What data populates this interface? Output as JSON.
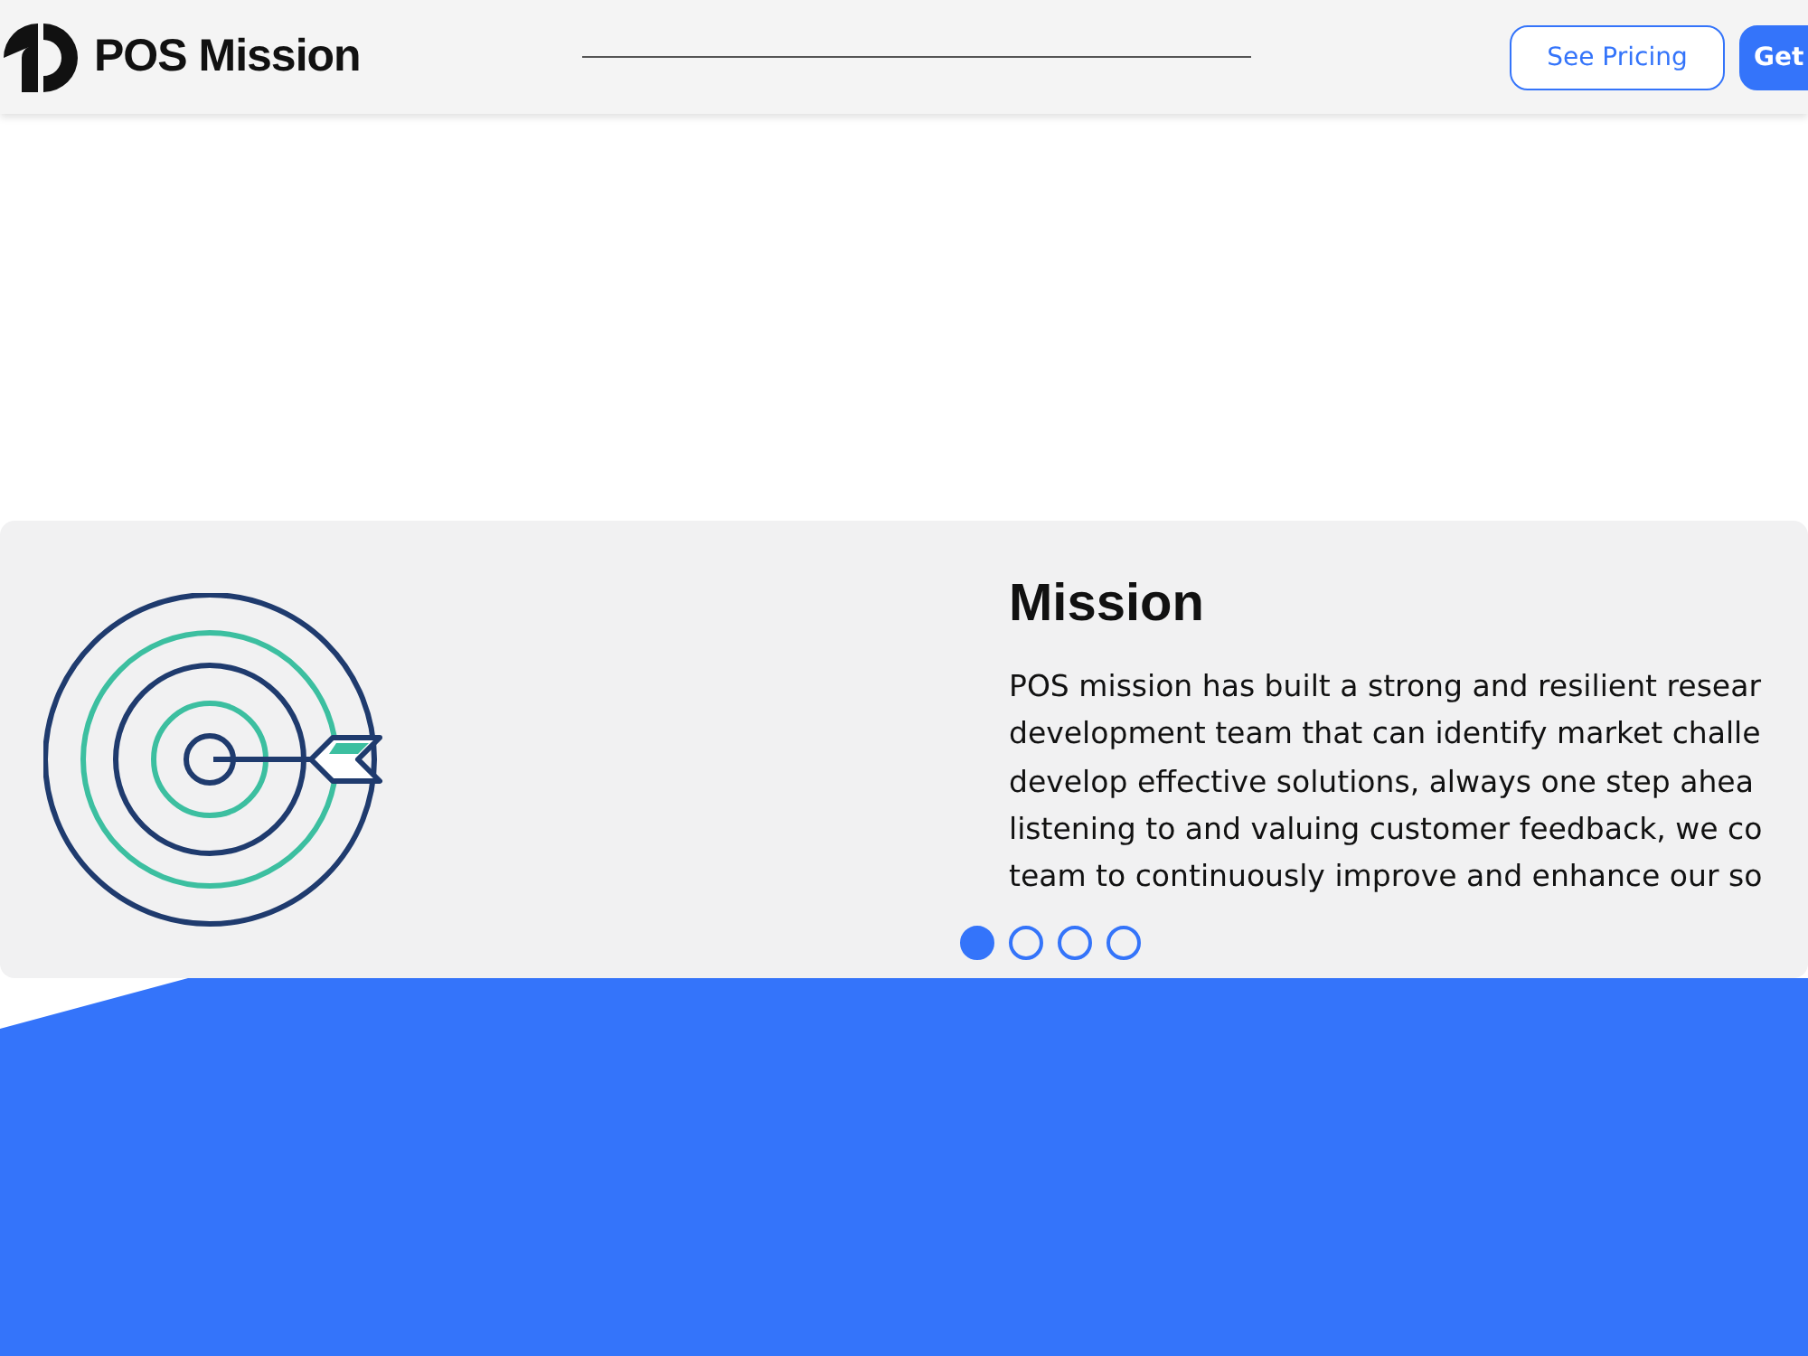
{
  "header": {
    "brand": "POS Mission",
    "buttons": [
      {
        "label": "See Pricing",
        "kind": "outline"
      },
      {
        "label": "Get",
        "kind": "solid"
      }
    ]
  },
  "slide": {
    "title": "Mission",
    "lines": [
      "POS mission has built a strong and resilient resear",
      "development team that can identify market challe",
      "develop effective solutions, always one step ahea",
      "listening to and valuing customer feedback, we co",
      "team to continuously improve and enhance our so"
    ]
  },
  "dots": [
    {
      "selected": true
    },
    {
      "selected": false
    },
    {
      "selected": false
    },
    {
      "selected": false
    }
  ]
}
